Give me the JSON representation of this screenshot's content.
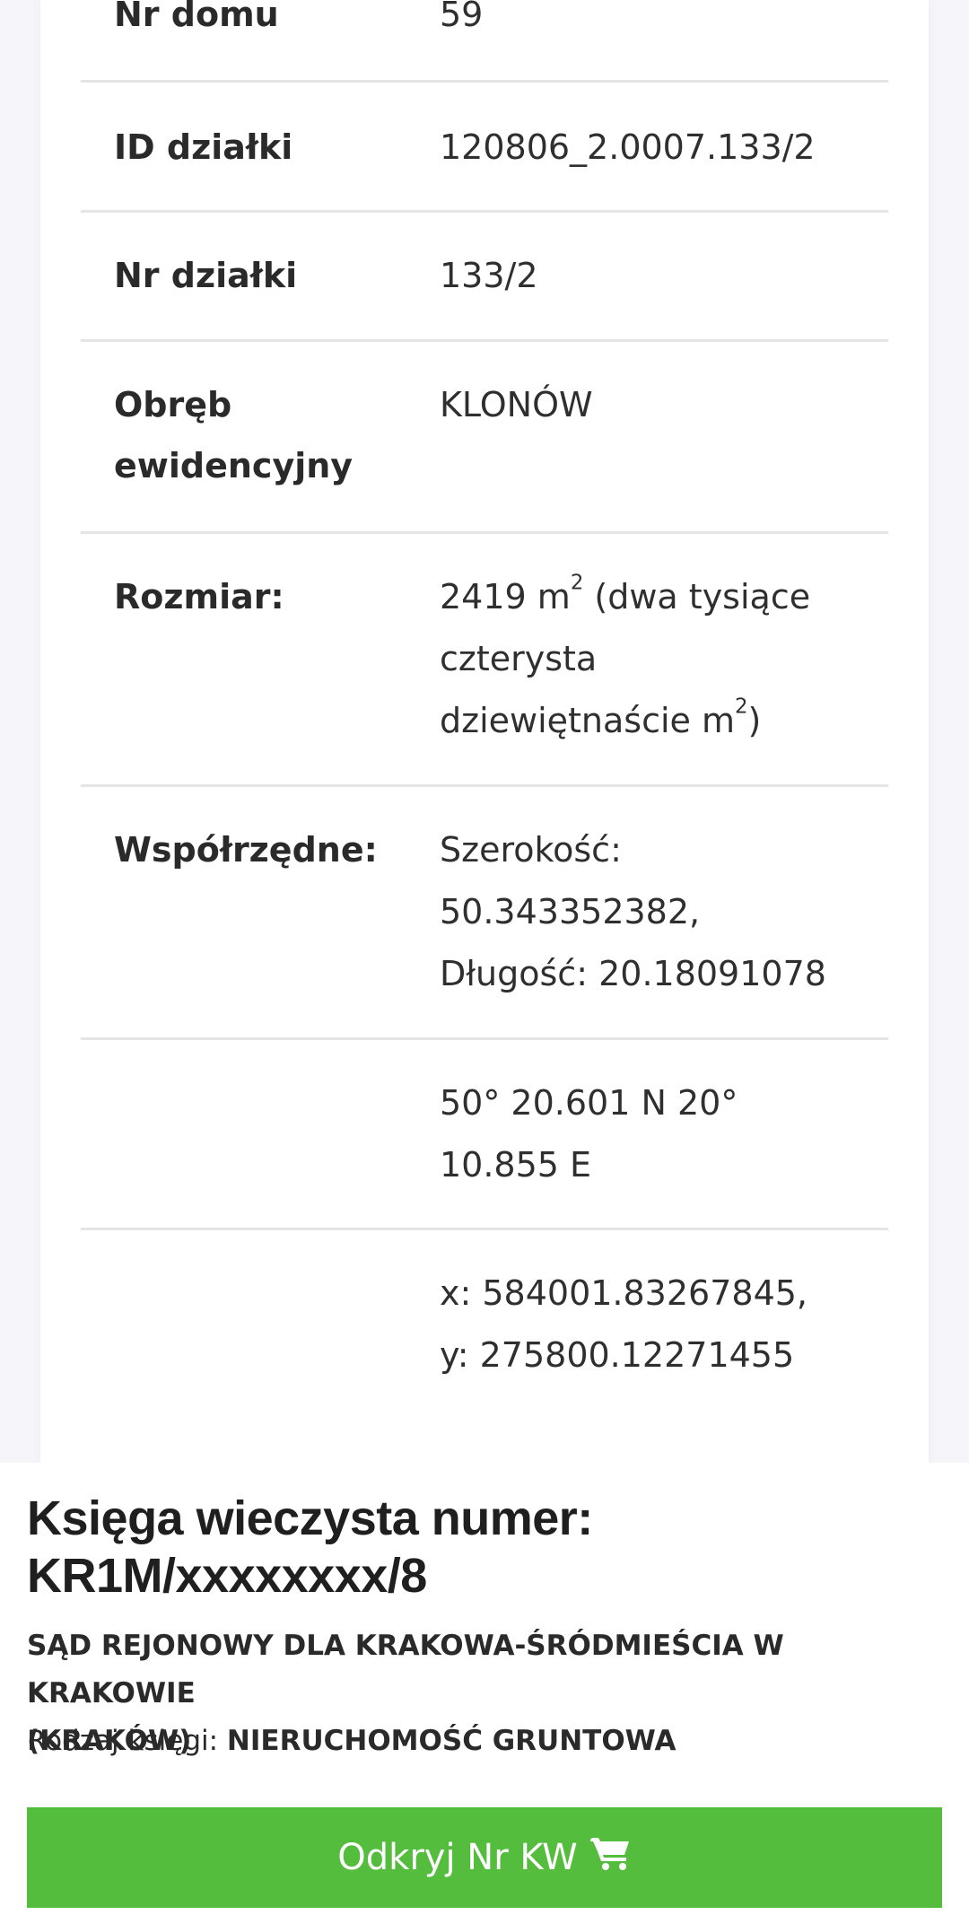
{
  "details": {
    "house_number": {
      "label": "Nr domu",
      "value": "59"
    },
    "plot_id": {
      "label": "ID działki",
      "value": "120806_2.0007.133/2"
    },
    "plot_number": {
      "label": "Nr działki",
      "value": "133/2"
    },
    "precinct": {
      "label_line1": "Obręb",
      "label_line2": "ewidencyjny",
      "value": "KLONÓW"
    },
    "size": {
      "label": "Rozmiar:",
      "area": "2419 m",
      "unit_sup": "2",
      "words_part1": " (dwa tysiące",
      "words_part2": "czterysta",
      "words_part3": "dziewiętnaście m",
      "words_close": ")"
    },
    "coordinates": {
      "label": "Współrzędne:",
      "lat_label": "Szerokość:",
      "lat_value": "50.343352382,",
      "lon_line": "Długość: 20.18091078"
    },
    "dms": {
      "line1": "50° 20.601 N 20°",
      "line2": "10.855 E"
    },
    "xy": {
      "line1": "x: 584001.83267845,",
      "line2": "y: 275800.12271455"
    }
  },
  "land_register": {
    "title_line1": "Księga wieczysta numer:",
    "title_line2": "KR1M/xxxxxxxx/8",
    "court_line1": "SĄD REJONOWY DLA KRAKOWA-ŚRÓDMIEŚCIA W KRAKOWIE",
    "court_line2": "(KRAKÓW)",
    "type_label": "Rodzaj księgi:",
    "type_value": "NIERUCHOMOŚĆ GRUNTOWA",
    "button_label": "Odkryj Nr KW",
    "button_icon": "cart-icon"
  },
  "colors": {
    "button_green": "#55bd3d",
    "divider": "#e5e5e5",
    "page_background": "#f6f6fa"
  }
}
